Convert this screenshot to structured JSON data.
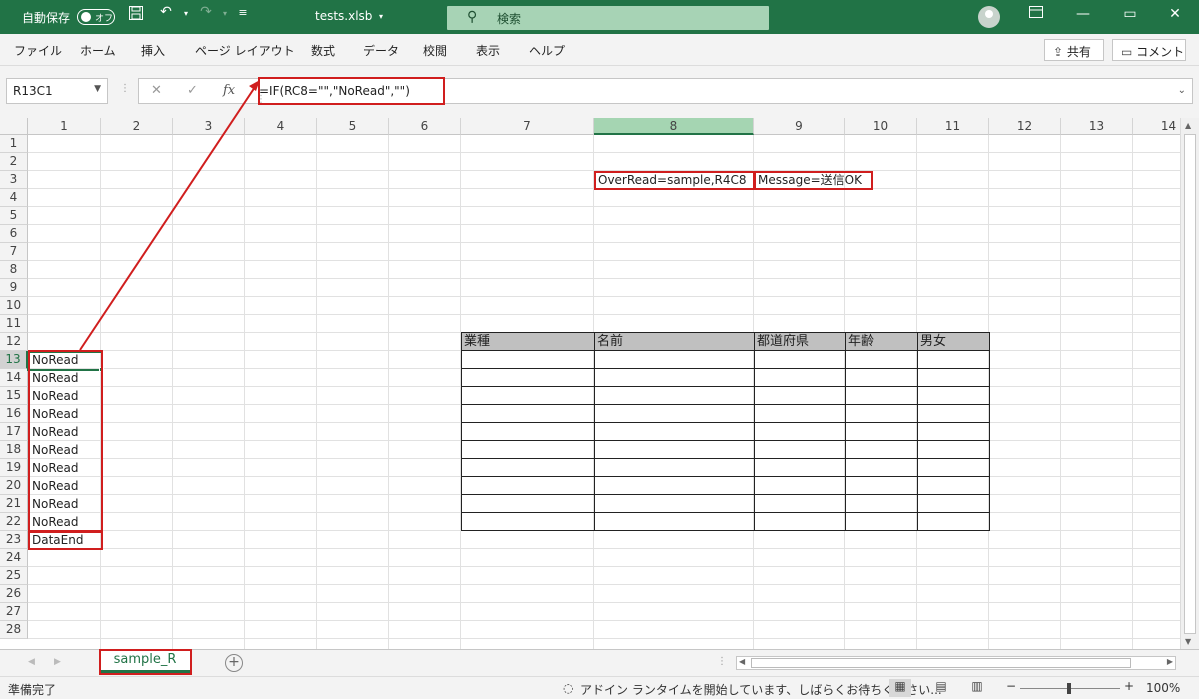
{
  "titlebar": {
    "autosave_label": "自動保存",
    "autosave_state": "オフ",
    "filename": "tests.xlsb",
    "search_placeholder": "検索",
    "minimize": "—",
    "restore": "▭",
    "close": "✕"
  },
  "ribbon": {
    "tabs": [
      "ファイル",
      "ホーム",
      "挿入",
      "ページ レイアウト",
      "数式",
      "データ",
      "校閲",
      "表示",
      "ヘルプ"
    ],
    "share": "共有",
    "comments": "コメント"
  },
  "formula_bar": {
    "name_box": "R13C1",
    "formula": "=IF(RC8=\"\",\"NoRead\",\"\")"
  },
  "sheet": {
    "columns": [
      "1",
      "2",
      "3",
      "4",
      "5",
      "6",
      "7",
      "8",
      "9",
      "10",
      "11",
      "12",
      "13",
      "14"
    ],
    "rows": [
      "1",
      "2",
      "3",
      "4",
      "5",
      "6",
      "7",
      "8",
      "9",
      "10",
      "11",
      "12",
      "13",
      "14",
      "15",
      "16",
      "17",
      "18",
      "19",
      "20",
      "21",
      "22",
      "23",
      "24",
      "25",
      "26",
      "27",
      "28"
    ],
    "selected_column": "8",
    "selected_row": "13",
    "cells": {
      "r3c8": "OverRead=sample,R4C8",
      "r3c9": "Message=送信OK",
      "r13c1": "NoRead",
      "r14c1": "NoRead",
      "r15c1": "NoRead",
      "r16c1": "NoRead",
      "r17c1": "NoRead",
      "r18c1": "NoRead",
      "r19c1": "NoRead",
      "r20c1": "NoRead",
      "r21c1": "NoRead",
      "r22c1": "NoRead",
      "r23c1": "DataEnd"
    },
    "table_headers": [
      "業種",
      "名前",
      "都道府県",
      "年齢",
      "男女"
    ]
  },
  "sheet_tabs": {
    "active": "sample_R",
    "add": "+"
  },
  "status": {
    "ready": "準備完了",
    "addin_message": "アドイン ランタイムを開始しています、しばらくお待ちください...",
    "zoom_minus": "−",
    "zoom_plus": "+",
    "zoom": "100%"
  }
}
